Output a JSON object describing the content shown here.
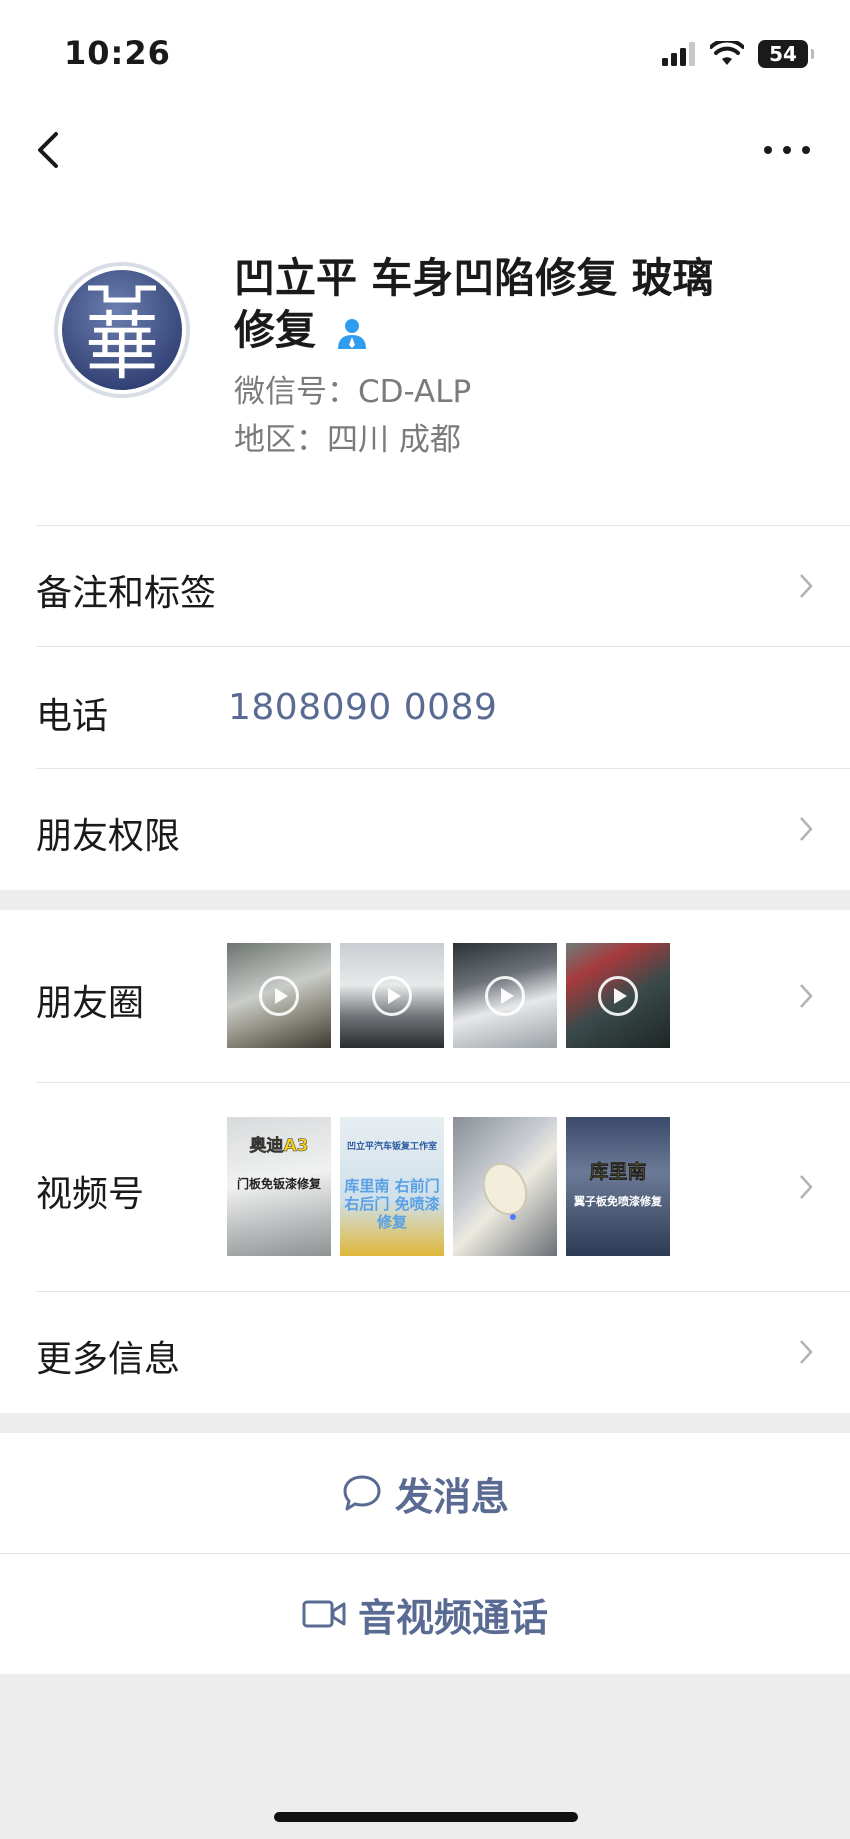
{
  "status": {
    "time": "10:26",
    "battery": "54"
  },
  "profile": {
    "name_line1": "凹立平 车身凹陷修复 玻璃",
    "name_line2": "修复",
    "wechat_id": "微信号：CD-ALP",
    "region": "地区：四川 成都",
    "avatar_char": "華"
  },
  "rows": {
    "remarks": "备注和标签",
    "phone_label": "电话",
    "phone_value": "1808090 0089",
    "permissions": "朋友权限",
    "moments": "朋友圈",
    "channels": "视频号",
    "more_info": "更多信息"
  },
  "channels_thumbs": [
    {
      "title": "奥迪A3",
      "sub": "门板免钣漆修复"
    },
    {
      "title": "凹立平汽车钣复工作室",
      "sub": "库里南 右前门右后门 免喷漆修复"
    },
    {
      "title": "",
      "sub": ""
    },
    {
      "title": "库里南",
      "sub": "翼子板免喷漆修复"
    }
  ],
  "actions": {
    "message": "发消息",
    "call": "音视频通话"
  },
  "colors": {
    "link": "#5a6b93",
    "background": "#ededed",
    "verified": "#2f9cf0"
  }
}
